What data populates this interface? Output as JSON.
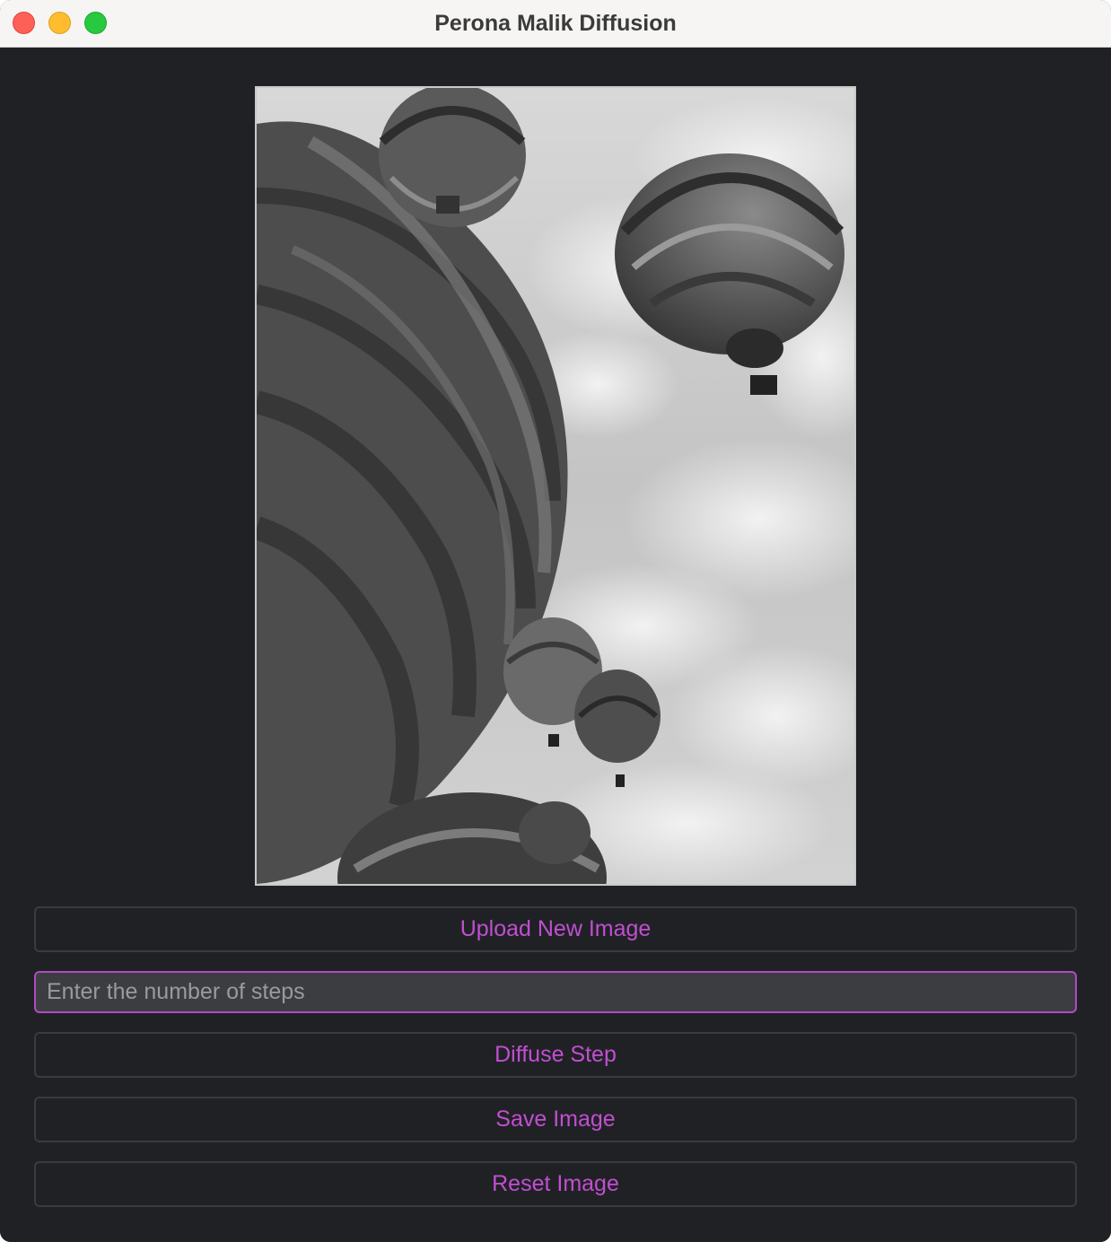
{
  "window": {
    "title": "Perona Malik Diffusion"
  },
  "image": {
    "description_icon": "image-icon"
  },
  "buttons": {
    "upload": "Upload New Image",
    "diffuse": "Diffuse Step",
    "save": "Save Image",
    "reset": "Reset Image"
  },
  "steps_input": {
    "placeholder": "Enter the number of steps",
    "value": ""
  },
  "colors": {
    "background": "#202125",
    "accent": "#c04fd0",
    "input_border": "#b04ac4",
    "titlebar": "#f6f5f4"
  }
}
